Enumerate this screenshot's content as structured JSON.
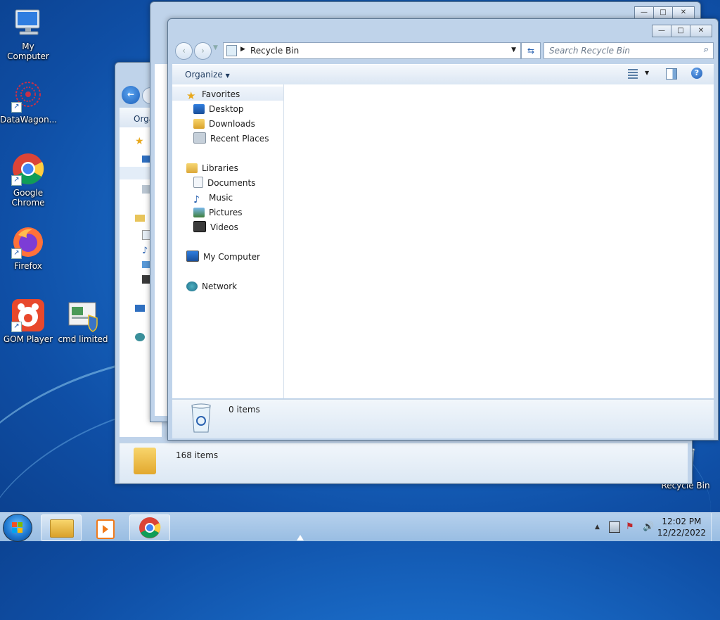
{
  "desktop": {
    "icons": [
      {
        "label": "My Computer"
      },
      {
        "label": "DataWagon..."
      },
      {
        "label": "Google Chrome"
      },
      {
        "label": "Firefox"
      },
      {
        "label": "GOM Player"
      },
      {
        "label": "cmd limited"
      },
      {
        "label": "Recycle Bin"
      }
    ]
  },
  "front_window": {
    "address": "Recycle Bin",
    "search_placeholder": "Search Recycle Bin",
    "organize_label": "Organize",
    "nav": {
      "favorites": "Favorites",
      "desktop": "Desktop",
      "downloads": "Downloads",
      "recent": "Recent Places",
      "libraries": "Libraries",
      "documents": "Documents",
      "music": "Music",
      "pictures": "Pictures",
      "videos": "Videos",
      "computer": "My Computer",
      "network": "Network"
    },
    "status": "0 items"
  },
  "back_window": {
    "organize_partial": "Orga",
    "status": "168 items"
  },
  "taskbar": {
    "time": "12:02 PM",
    "date": "12/22/2022"
  },
  "colors": {
    "desktop_blue": "#1a6cc8",
    "window_frame": "#bfd3ea",
    "accent": "#2a62b0"
  }
}
